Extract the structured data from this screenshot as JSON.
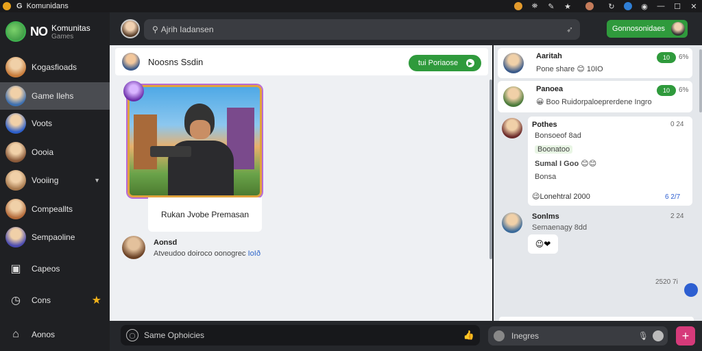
{
  "titlebar": {
    "app_name": "Komunidans",
    "app_g": "G"
  },
  "sidebar": {
    "brand_mark": "NO",
    "brand_title": "Komunitas",
    "brand_sub": "Games",
    "items": [
      {
        "label": "Kogasfioads",
        "icon": "avatar",
        "color": "#c77b3a"
      },
      {
        "label": "Game Ilehs",
        "icon": "avatar",
        "color": "#3c6fb0",
        "active": true
      },
      {
        "label": "Voots",
        "icon": "avatar",
        "color": "#2c5ec9"
      },
      {
        "label": "Oooia",
        "icon": "avatar",
        "color": "#8a5a3a"
      },
      {
        "label": "Vooiing",
        "icon": "avatar",
        "color": "#a7794e",
        "chevron": "▼"
      },
      {
        "label": "Compeallts",
        "icon": "avatar",
        "color": "#b36a3a"
      },
      {
        "label": "Sempaoline",
        "icon": "avatar",
        "color": "#4a4ab0"
      },
      {
        "label": "Capeos",
        "icon": "gallery-icon"
      },
      {
        "label": "Cons",
        "icon": "clock-icon",
        "star": "★"
      },
      {
        "label": "Aonos",
        "icon": "home-icon"
      }
    ]
  },
  "topbar": {
    "search_placeholder": "Ajrih Iadansen",
    "button_label": "Gonnosonidaes"
  },
  "main": {
    "chat_title": "Noosns Ssdin",
    "pill_label": "tui Poriaose",
    "card_caption": "Rukan Jvobe Premasan",
    "msg2_name": "Aonsd",
    "msg2_text": "Atveudoo doiroco oonogrec",
    "msg2_link": "IoIð"
  },
  "right": {
    "cards": [
      {
        "name": "Aaritah",
        "text": "Pone share 😊 10IO",
        "badge": "10",
        "meta": "6%"
      },
      {
        "name": "Panoea",
        "text": "😀 Boo Ruidorpaloeprerdene Ingro",
        "badge": "10",
        "meta": "6%"
      },
      {
        "name": "Pothes",
        "text": "Bonsoeof 8ad",
        "meta": "0 24",
        "line2": "Boonatoo",
        "line3": "Sumal I Goo 😊😊",
        "line4": "Bonsa",
        "line5": "😉Lonehtral 2000",
        "time": "6 2/7"
      },
      {
        "name": "Sonlms",
        "text": "Semaenagy 8dd",
        "meta": "2 24",
        "emoji": "😉❤"
      }
    ],
    "footer_time": "2520 7i"
  },
  "bottom": {
    "input1_placeholder": "Same Ophoicies",
    "input2_placeholder": "Inegres"
  },
  "colors": {
    "accent": "#2f9a3c",
    "add": "#d63a7a",
    "sidebar": "#1f2023"
  }
}
